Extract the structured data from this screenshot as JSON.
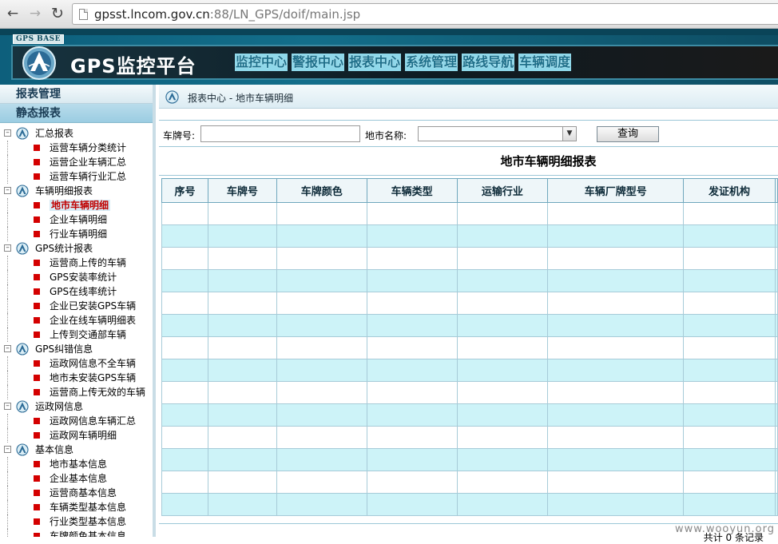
{
  "browser": {
    "url_host": "gpsst.lncom.gov.cn",
    "url_rest": ":88/LN_GPS/doif/main.jsp"
  },
  "banner": {
    "base_tag": "GPS BASE",
    "app_title": "GPS监控平台",
    "menu": [
      "监控中心",
      "警报中心",
      "报表中心",
      "系统管理",
      "路线导航",
      "车辆调度"
    ]
  },
  "sidebar": {
    "header": "报表管理",
    "section": "静态报表",
    "groups": [
      {
        "label": "汇总报表",
        "items": [
          "运营车辆分类统计",
          "运营企业车辆汇总",
          "运营车辆行业汇总"
        ]
      },
      {
        "label": "车辆明细报表",
        "items": [
          "地市车辆明细",
          "企业车辆明细",
          "行业车辆明细"
        ]
      },
      {
        "label": "GPS统计报表",
        "items": [
          "运营商上传的车辆",
          "GPS安装率统计",
          "GPS在线率统计",
          "企业已安装GPS车辆",
          "企业在线车辆明细表",
          "上传到交通部车辆"
        ]
      },
      {
        "label": "GPS纠错信息",
        "items": [
          "运政网信息不全车辆",
          "地市未安装GPS车辆",
          "运营商上传无效的车辆"
        ]
      },
      {
        "label": "运政网信息",
        "items": [
          "运政网信息车辆汇总",
          "运政网车辆明细"
        ]
      },
      {
        "label": "基本信息",
        "items": [
          "地市基本信息",
          "企业基本信息",
          "运营商基本信息",
          "车辆类型基本信息",
          "行业类型基本信息",
          "车牌颜色基本信息"
        ]
      }
    ],
    "selected": "地市车辆明细"
  },
  "main": {
    "breadcrumb": "报表中心 - 地市车辆明细",
    "filter": {
      "plate_label": "车牌号:",
      "plate_value": "",
      "city_label": "地市名称:",
      "city_value": "",
      "query_button": "查询"
    },
    "report_title": "地市车辆明细报表",
    "columns": [
      "序号",
      "车牌号",
      "车牌颜色",
      "车辆类型",
      "运输行业",
      "车辆厂牌型号",
      "发证机构"
    ],
    "footer": "共计 0 条记录"
  },
  "colors": {
    "accent": "#136e8a",
    "menu_bg": "#8fd8ea",
    "row_alt": "#cdf3f8",
    "bullet": "#d40000"
  },
  "watermark": "www.wooyun.org"
}
